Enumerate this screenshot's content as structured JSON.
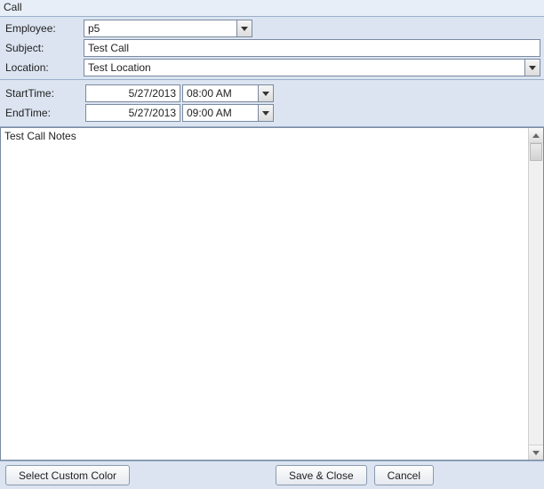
{
  "window": {
    "title": "Call"
  },
  "fields": {
    "employee": {
      "label": "Employee:",
      "value": "p5"
    },
    "subject": {
      "label": "Subject:",
      "value": "Test Call"
    },
    "location": {
      "label": "Location:",
      "value": "Test Location"
    }
  },
  "times": {
    "start": {
      "label": "StartTime:",
      "date": "5/27/2013",
      "time": "08:00 AM"
    },
    "end": {
      "label": "EndTime:",
      "date": "5/27/2013",
      "time": "09:00 AM"
    }
  },
  "notes": {
    "value": "Test Call Notes"
  },
  "buttons": {
    "custom_color": "Select Custom Color",
    "save_close": "Save & Close",
    "cancel": "Cancel"
  }
}
